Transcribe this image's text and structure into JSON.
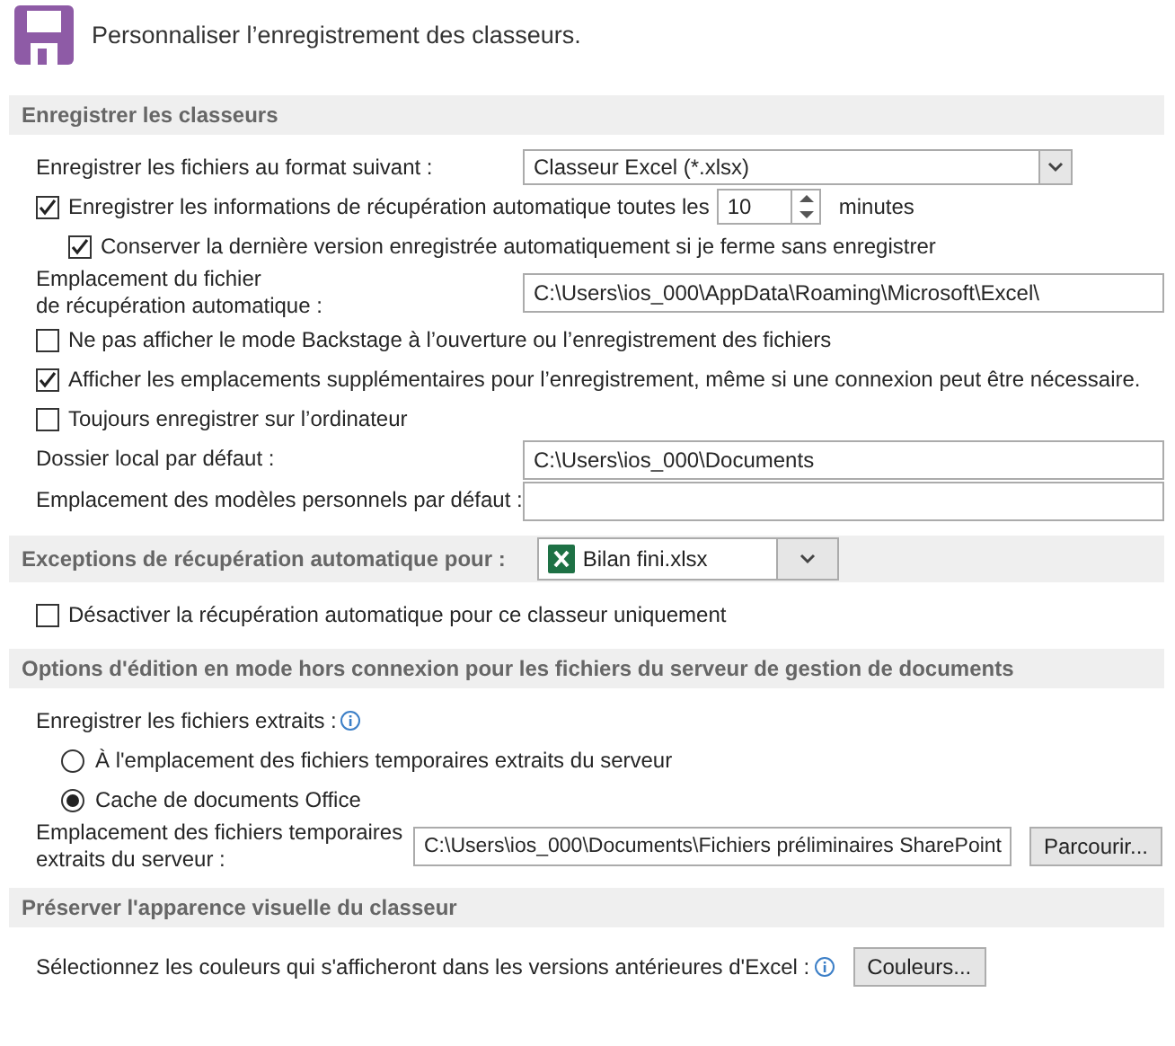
{
  "header": {
    "title": "Personnaliser l’enregistrement des classeurs."
  },
  "sections": [
    {
      "title": "Enregistrer les classeurs",
      "rows": [
        {
          "kind": "select",
          "label": "Enregistrer les fichiers au format suivant :",
          "value": "Classeur Excel (*.xlsx)"
        },
        {
          "kind": "checkbox-spin",
          "label": "Enregistrer les informations de récupération automatique toutes les",
          "checked": true,
          "value": "10",
          "unit": "minutes",
          "children": [
            {
              "kind": "checkbox",
              "label": "Conserver la dernière version enregistrée automatiquement si je ferme sans enregistrer",
              "checked": true
            }
          ]
        },
        {
          "kind": "field",
          "label": "Emplacement du fichier\nde récupération automatique :",
          "value": "C:\\Users\\ios_000\\AppData\\Roaming\\Microsoft\\Excel\\"
        },
        {
          "kind": "checkbox",
          "label": "Ne pas afficher le mode Backstage à l’ouverture ou l’enregistrement des fichiers",
          "checked": false
        },
        {
          "kind": "checkbox",
          "label": "Afficher les emplacements supplémentaires pour l’enregistrement, même si une connexion peut être nécessaire.",
          "checked": true
        },
        {
          "kind": "checkbox",
          "label": "Toujours enregistrer sur l’ordinateur",
          "checked": false
        },
        {
          "kind": "field",
          "label": "Dossier local par défaut :",
          "value": "C:\\Users\\ios_000\\Documents"
        },
        {
          "kind": "field",
          "label": "Emplacement des modèles personnels par défaut :"
        }
      ]
    },
    {
      "title": "Exceptions de récupération automatique pour :",
      "workbook": "Bilan fini.xlsx",
      "rows": [
        {
          "kind": "checkbox",
          "label": "Désactiver la récupération automatique pour ce classeur uniquement",
          "checked": false
        }
      ]
    },
    {
      "title": "Options d'édition en mode hors connexion pour les fichiers du serveur de gestion de documents",
      "rows": [
        {
          "kind": "info-label",
          "label": "Enregistrer les fichiers extraits :"
        },
        {
          "kind": "radio",
          "label": "À l'emplacement des fichiers temporaires extraits du serveur",
          "selected": false
        },
        {
          "kind": "radio",
          "label": "Cache de documents Office",
          "selected": true
        },
        {
          "kind": "field-button",
          "label": "Emplacement des fichiers temporaires\nextraits du serveur :",
          "value": "C:\\Users\\ios_000\\Documents\\Fichiers préliminaires SharePoint",
          "button": "Parcourir..."
        }
      ]
    },
    {
      "title": "Préserver l'apparence visuelle du classeur",
      "rows": [
        {
          "kind": "info-button",
          "label": "Sélectionnez les couleurs qui s'afficheront dans les versions antérieures d'Excel :",
          "button": "Couleurs..."
        }
      ]
    }
  ]
}
